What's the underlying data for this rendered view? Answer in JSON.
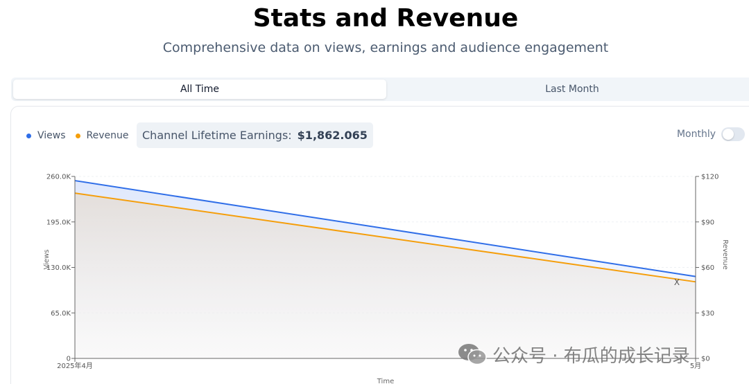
{
  "header": {
    "title": "Stats and Revenue",
    "subtitle": "Comprehensive data on views, earnings and audience engagement"
  },
  "tabs": [
    {
      "label": "All Time",
      "active": true
    },
    {
      "label": "Last Month",
      "active": false
    }
  ],
  "legend": [
    {
      "label": "Views",
      "color": "#2f6ee8"
    },
    {
      "label": "Revenue",
      "color": "#f59e0b"
    }
  ],
  "earnings": {
    "label": "Channel Lifetime Earnings:",
    "value": "$1,862.065"
  },
  "toggle": {
    "label": "Monthly",
    "on": false
  },
  "watermark": {
    "text": "公众号 · 布瓜的成长记录",
    "icon": "wechat-icon"
  },
  "chart_data": {
    "type": "area",
    "x": [
      "2025年4月",
      "5月"
    ],
    "xlabel": "Time",
    "ylabel_left": "Views",
    "ylabel_right": "Revenue",
    "left_axis": {
      "ylim": [
        0,
        260000
      ],
      "ticks": [
        0,
        65000,
        130000,
        195000,
        260000
      ],
      "tick_labels": [
        "0",
        "65.0K",
        "130.0K",
        "195.0K",
        "260.0K"
      ]
    },
    "right_axis": {
      "ylim": [
        0,
        120
      ],
      "ticks": [
        0,
        30,
        60,
        90,
        120
      ],
      "tick_labels": [
        "$0",
        "$30",
        "$60",
        "$90",
        "$120"
      ]
    },
    "series": [
      {
        "name": "Views",
        "axis": "left",
        "color": "#2f6ee8",
        "values": [
          254000,
          117000
        ]
      },
      {
        "name": "Revenue",
        "axis": "right",
        "color": "#f59e0b",
        "values": [
          109,
          50.5
        ]
      }
    ],
    "marker_text": "X",
    "grid": true
  }
}
